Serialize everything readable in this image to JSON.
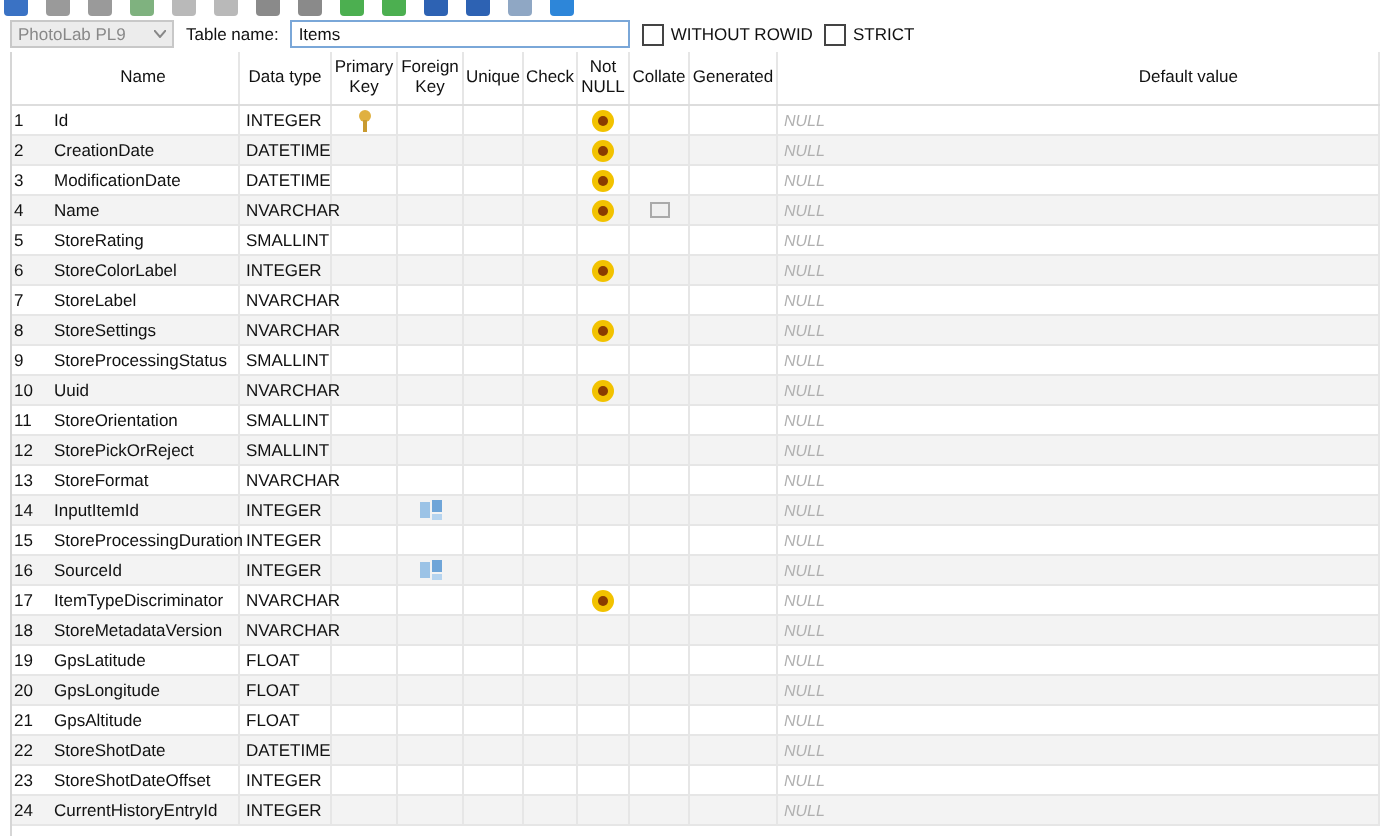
{
  "database_select": {
    "value": "PhotoLab PL9",
    "disabled": true
  },
  "table_name": {
    "label": "Table name:",
    "value": "Items"
  },
  "options": [
    {
      "label": "WITHOUT ROWID",
      "checked": false
    },
    {
      "label": "STRICT",
      "checked": false
    }
  ],
  "columns": [
    "Name",
    "Data type",
    "Primary Key",
    "Foreign Key",
    "Unique",
    "Check",
    "Not NULL",
    "Collate",
    "Generated",
    "Default value"
  ],
  "rows": [
    {
      "number": "1",
      "name": "Id",
      "type": "INTEGER",
      "primary_key": true,
      "foreign_key": false,
      "not_null": true,
      "collate": false,
      "default": "NULL"
    },
    {
      "number": "2",
      "name": "CreationDate",
      "type": "DATETIME",
      "primary_key": false,
      "foreign_key": false,
      "not_null": true,
      "collate": false,
      "default": "NULL"
    },
    {
      "number": "3",
      "name": "ModificationDate",
      "type": "DATETIME",
      "primary_key": false,
      "foreign_key": false,
      "not_null": true,
      "collate": false,
      "default": "NULL"
    },
    {
      "number": "4",
      "name": "Name",
      "type": "NVARCHAR",
      "primary_key": false,
      "foreign_key": false,
      "not_null": true,
      "collate": true,
      "default": "NULL"
    },
    {
      "number": "5",
      "name": "StoreRating",
      "type": "SMALLINT",
      "primary_key": false,
      "foreign_key": false,
      "not_null": false,
      "collate": false,
      "default": "NULL"
    },
    {
      "number": "6",
      "name": "StoreColorLabel",
      "type": "INTEGER",
      "primary_key": false,
      "foreign_key": false,
      "not_null": true,
      "collate": false,
      "default": "NULL"
    },
    {
      "number": "7",
      "name": "StoreLabel",
      "type": "NVARCHAR",
      "primary_key": false,
      "foreign_key": false,
      "not_null": false,
      "collate": false,
      "default": "NULL"
    },
    {
      "number": "8",
      "name": "StoreSettings",
      "type": "NVARCHAR",
      "primary_key": false,
      "foreign_key": false,
      "not_null": true,
      "collate": false,
      "default": "NULL"
    },
    {
      "number": "9",
      "name": "StoreProcessingStatus",
      "type": "SMALLINT",
      "primary_key": false,
      "foreign_key": false,
      "not_null": false,
      "collate": false,
      "default": "NULL"
    },
    {
      "number": "10",
      "name": "Uuid",
      "type": "NVARCHAR",
      "primary_key": false,
      "foreign_key": false,
      "not_null": true,
      "collate": false,
      "default": "NULL"
    },
    {
      "number": "11",
      "name": "StoreOrientation",
      "type": "SMALLINT",
      "primary_key": false,
      "foreign_key": false,
      "not_null": false,
      "collate": false,
      "default": "NULL"
    },
    {
      "number": "12",
      "name": "StorePickOrReject",
      "type": "SMALLINT",
      "primary_key": false,
      "foreign_key": false,
      "not_null": false,
      "collate": false,
      "default": "NULL"
    },
    {
      "number": "13",
      "name": "StoreFormat",
      "type": "NVARCHAR",
      "primary_key": false,
      "foreign_key": false,
      "not_null": false,
      "collate": false,
      "default": "NULL"
    },
    {
      "number": "14",
      "name": "InputItemId",
      "type": "INTEGER",
      "primary_key": false,
      "foreign_key": true,
      "not_null": false,
      "collate": false,
      "default": "NULL"
    },
    {
      "number": "15",
      "name": "StoreProcessingDuration",
      "type": "INTEGER",
      "primary_key": false,
      "foreign_key": false,
      "not_null": false,
      "collate": false,
      "default": "NULL"
    },
    {
      "number": "16",
      "name": "SourceId",
      "type": "INTEGER",
      "primary_key": false,
      "foreign_key": true,
      "not_null": false,
      "collate": false,
      "default": "NULL"
    },
    {
      "number": "17",
      "name": "ItemTypeDiscriminator",
      "type": "NVARCHAR",
      "primary_key": false,
      "foreign_key": false,
      "not_null": true,
      "collate": false,
      "default": "NULL"
    },
    {
      "number": "18",
      "name": "StoreMetadataVersion",
      "type": "NVARCHAR",
      "primary_key": false,
      "foreign_key": false,
      "not_null": false,
      "collate": false,
      "default": "NULL"
    },
    {
      "number": "19",
      "name": "GpsLatitude",
      "type": "FLOAT",
      "primary_key": false,
      "foreign_key": false,
      "not_null": false,
      "collate": false,
      "default": "NULL"
    },
    {
      "number": "20",
      "name": "GpsLongitude",
      "type": "FLOAT",
      "primary_key": false,
      "foreign_key": false,
      "not_null": false,
      "collate": false,
      "default": "NULL"
    },
    {
      "number": "21",
      "name": "GpsAltitude",
      "type": "FLOAT",
      "primary_key": false,
      "foreign_key": false,
      "not_null": false,
      "collate": false,
      "default": "NULL"
    },
    {
      "number": "22",
      "name": "StoreShotDate",
      "type": "DATETIME",
      "primary_key": false,
      "foreign_key": false,
      "not_null": false,
      "collate": false,
      "default": "NULL"
    },
    {
      "number": "23",
      "name": "StoreShotDateOffset",
      "type": "INTEGER",
      "primary_key": false,
      "foreign_key": false,
      "not_null": false,
      "collate": false,
      "default": "NULL"
    },
    {
      "number": "24",
      "name": "CurrentHistoryEntryId",
      "type": "INTEGER",
      "primary_key": false,
      "foreign_key": false,
      "not_null": false,
      "collate": false,
      "default": "NULL"
    }
  ]
}
